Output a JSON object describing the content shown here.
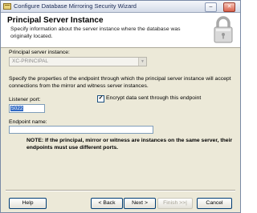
{
  "window": {
    "title": "Configure Database Mirroring Security Wizard",
    "min_label": "–",
    "close_label": "✕"
  },
  "header": {
    "title": "Principal Server Instance",
    "subtitle": "Specify information about the server instance where the database was originally located."
  },
  "form": {
    "instance_label": "Principal server instance:",
    "instance_value": "XC-PRINCIPAL",
    "description": "Specify the properties of the endpoint through which the principal server instance will accept connections from the mirror and witness server instances.",
    "port_label": "Listener port:",
    "port_value": "5022",
    "encrypt_label": "Encrypt data sent through this endpoint",
    "encrypt_checked": true,
    "encrypt_mark": "✓",
    "endpoint_label": "Endpoint name:",
    "endpoint_value": "",
    "note": "NOTE: If the principal, mirror or witness are instances on the same server, their endpoints must use different ports."
  },
  "buttons": {
    "help": "Help",
    "back": "< Back",
    "next": "Next >",
    "finish": "Finish >>|",
    "cancel": "Cancel"
  },
  "icons": {
    "app": "wizard-icon",
    "lock": "padlock-icon",
    "combo_arrow": "chevron-down-icon"
  }
}
